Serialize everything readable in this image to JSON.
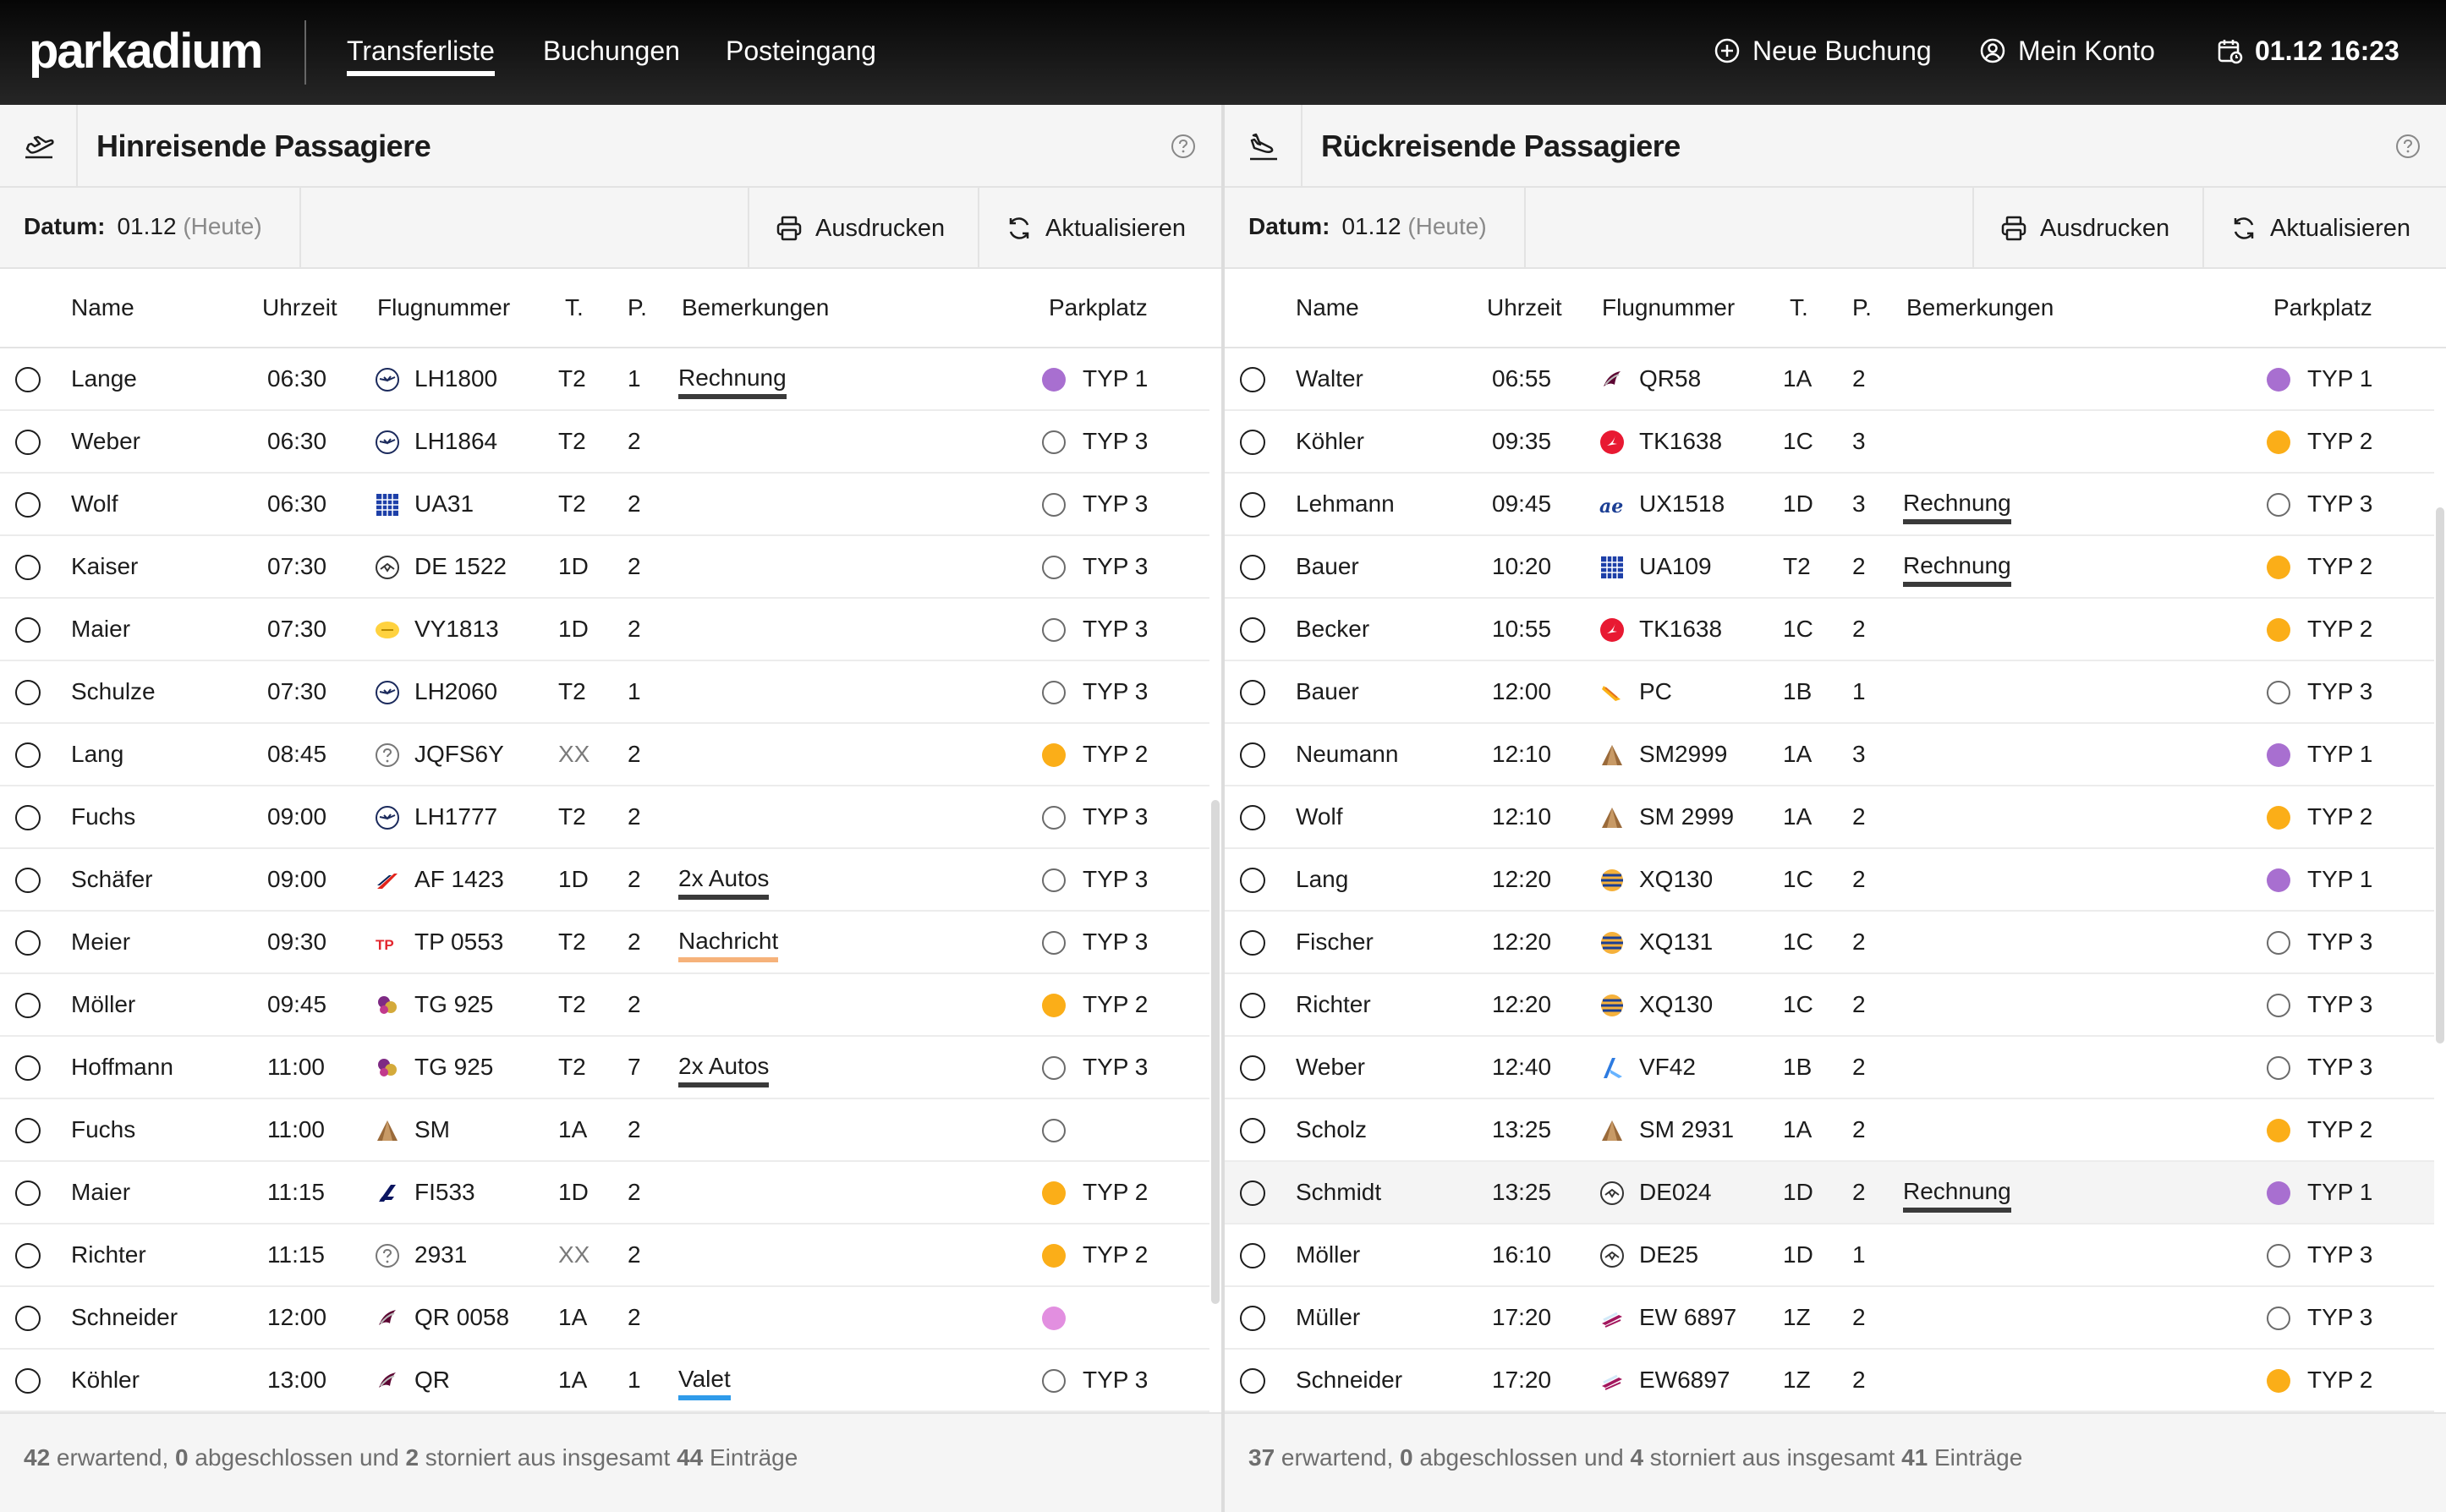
{
  "app": {
    "logo": "parkadium"
  },
  "nav": {
    "items": [
      "Transferliste",
      "Buchungen",
      "Posteingang"
    ],
    "active": "Transferliste"
  },
  "topbar": {
    "new_booking": "Neue Buchung",
    "account": "Mein Konto",
    "datetime": "01.12  16:23"
  },
  "colors": {
    "purple": "#a86fd0",
    "orange": "#fbae18",
    "pink": "#e28fe0",
    "note_default": "#3a3a3a",
    "note_orange": "#f6b27a",
    "note_blue": "#2f9bea"
  },
  "left": {
    "title": "Hinreisende Passagiere",
    "icon": "plane-departure-icon",
    "date_label": "Datum:",
    "date_value": "01.12",
    "date_hint": "(Heute)",
    "print_label": "Ausdrucken",
    "refresh_label": "Aktualisieren",
    "columns": [
      "Name",
      "Uhrzeit",
      "Flugnummer",
      "T.",
      "P.",
      "Bemerkungen",
      "Parkplatz"
    ],
    "rows": [
      {
        "name": "Lange",
        "time": "06:30",
        "airline": "lufthansa-icon",
        "flight": "LH1800",
        "t": "T2",
        "p": "1",
        "note": "Rechnung",
        "note_color": "#3a3a3a",
        "park": "TYP 1",
        "dot": "#a86fd0"
      },
      {
        "name": "Weber",
        "time": "06:30",
        "airline": "lufthansa-icon",
        "flight": "LH1864",
        "t": "T2",
        "p": "2",
        "note": "",
        "park": "TYP 3",
        "dot": "empty"
      },
      {
        "name": "Wolf",
        "time": "06:30",
        "airline": "united-icon",
        "flight": "UA31",
        "t": "T2",
        "p": "2",
        "note": "",
        "park": "TYP 3",
        "dot": "empty"
      },
      {
        "name": "Kaiser",
        "time": "07:30",
        "airline": "condor-icon",
        "flight": "DE 1522",
        "t": "1D",
        "p": "2",
        "note": "",
        "park": "TYP 3",
        "dot": "empty"
      },
      {
        "name": "Maier",
        "time": "07:30",
        "airline": "vueling-icon",
        "flight": "VY1813",
        "t": "1D",
        "p": "2",
        "note": "",
        "park": "TYP 3",
        "dot": "empty"
      },
      {
        "name": "Schulze",
        "time": "07:30",
        "airline": "lufthansa-icon",
        "flight": "LH2060",
        "t": "T2",
        "p": "1",
        "note": "",
        "park": "TYP 3",
        "dot": "empty"
      },
      {
        "name": "Lang",
        "time": "08:45",
        "airline": "unknown-airline-icon",
        "flight": "JQFS6Y",
        "t": "XX",
        "p": "2",
        "note": "",
        "park": "TYP 2",
        "dot": "#fbae18"
      },
      {
        "name": "Fuchs",
        "time": "09:00",
        "airline": "lufthansa-icon",
        "flight": "LH1777",
        "t": "T2",
        "p": "2",
        "note": "",
        "park": "TYP 3",
        "dot": "empty"
      },
      {
        "name": "Schäfer",
        "time": "09:00",
        "airline": "air-france-icon",
        "flight": "AF 1423",
        "t": "1D",
        "p": "2",
        "note": "2x Autos",
        "note_color": "#3a3a3a",
        "park": "TYP 3",
        "dot": "empty"
      },
      {
        "name": "Meier",
        "time": "09:30",
        "airline": "tap-icon",
        "flight": "TP 0553",
        "t": "T2",
        "p": "2",
        "note": "Nachricht",
        "note_color": "#f6b27a",
        "park": "TYP 3",
        "dot": "empty"
      },
      {
        "name": "Möller",
        "time": "09:45",
        "airline": "thai-icon",
        "flight": "TG 925",
        "t": "T2",
        "p": "2",
        "note": "",
        "park": "TYP 2",
        "dot": "#fbae18"
      },
      {
        "name": "Hoffmann",
        "time": "11:00",
        "airline": "thai-icon",
        "flight": "TG 925",
        "t": "T2",
        "p": "7",
        "note": "2x Autos",
        "note_color": "#3a3a3a",
        "park": "TYP 3",
        "dot": "empty"
      },
      {
        "name": "Fuchs",
        "time": "11:00",
        "airline": "sas-icon",
        "flight": "SM",
        "t": "1A",
        "p": "2",
        "note": "",
        "park": "",
        "dot": "empty"
      },
      {
        "name": "Maier",
        "time": "11:15",
        "airline": "finnair-icon",
        "flight": "FI533",
        "t": "1D",
        "p": "2",
        "note": "",
        "park": "TYP 2",
        "dot": "#fbae18"
      },
      {
        "name": "Richter",
        "time": "11:15",
        "airline": "unknown-airline-icon",
        "flight": "2931",
        "t": "XX",
        "p": "2",
        "note": "",
        "park": "TYP 2",
        "dot": "#fbae18"
      },
      {
        "name": "Schneider",
        "time": "12:00",
        "airline": "qatar-icon",
        "flight": "QR 0058",
        "t": "1A",
        "p": "2",
        "note": "",
        "park": "",
        "dot": "#e28fe0"
      },
      {
        "name": "Köhler",
        "time": "13:00",
        "airline": "qatar-icon",
        "flight": "QR",
        "t": "1A",
        "p": "1",
        "note": "Valet",
        "note_color": "#2f9bea",
        "park": "TYP 3",
        "dot": "empty"
      }
    ],
    "footer": {
      "waiting": "42",
      "waiting_label": " erwartend, ",
      "done": "0",
      "done_label": " abgeschlossen und ",
      "cancelled": "2",
      "cancelled_label": " storniert aus insgesamt ",
      "total": "44",
      "total_label": " Einträge"
    }
  },
  "right": {
    "title": "Rückreisende Passagiere",
    "icon": "plane-arrival-icon",
    "date_label": "Datum:",
    "date_value": "01.12",
    "date_hint": "(Heute)",
    "print_label": "Ausdrucken",
    "refresh_label": "Aktualisieren",
    "columns": [
      "Name",
      "Uhrzeit",
      "Flugnummer",
      "T.",
      "P.",
      "Bemerkungen",
      "Parkplatz"
    ],
    "rows": [
      {
        "name": "Walter",
        "time": "06:55",
        "airline": "qatar-icon",
        "flight": "QR58",
        "t": "1A",
        "p": "2",
        "note": "",
        "park": "TYP 1",
        "dot": "#a86fd0"
      },
      {
        "name": "Köhler",
        "time": "09:35",
        "airline": "turkish-icon",
        "flight": "TK1638",
        "t": "1C",
        "p": "3",
        "note": "",
        "park": "TYP 2",
        "dot": "#fbae18"
      },
      {
        "name": "Lehmann",
        "time": "09:45",
        "airline": "air-europa-icon",
        "flight": "UX1518",
        "t": "1D",
        "p": "3",
        "note": "Rechnung",
        "note_color": "#3a3a3a",
        "park": "TYP 3",
        "dot": "empty"
      },
      {
        "name": "Bauer",
        "time": "10:20",
        "airline": "united-icon",
        "flight": "UA109",
        "t": "T2",
        "p": "2",
        "note": "Rechnung",
        "note_color": "#3a3a3a",
        "park": "TYP 2",
        "dot": "#fbae18"
      },
      {
        "name": "Becker",
        "time": "10:55",
        "airline": "turkish-icon",
        "flight": "TK1638",
        "t": "1C",
        "p": "2",
        "note": "",
        "park": "TYP 2",
        "dot": "#fbae18"
      },
      {
        "name": "Bauer",
        "time": "12:00",
        "airline": "pegasus-icon",
        "flight": "PC",
        "t": "1B",
        "p": "1",
        "note": "",
        "park": "TYP 3",
        "dot": "empty"
      },
      {
        "name": "Neumann",
        "time": "12:10",
        "airline": "sas-icon",
        "flight": "SM2999",
        "t": "1A",
        "p": "3",
        "note": "",
        "park": "TYP 1",
        "dot": "#a86fd0"
      },
      {
        "name": "Wolf",
        "time": "12:10",
        "airline": "sas-icon",
        "flight": "SM 2999",
        "t": "1A",
        "p": "2",
        "note": "",
        "park": "TYP 2",
        "dot": "#fbae18"
      },
      {
        "name": "Lang",
        "time": "12:20",
        "airline": "sunexpress-icon",
        "flight": "XQ130",
        "t": "1C",
        "p": "2",
        "note": "",
        "park": "TYP 1",
        "dot": "#a86fd0"
      },
      {
        "name": "Fischer",
        "time": "12:20",
        "airline": "sunexpress-icon",
        "flight": "XQ131",
        "t": "1C",
        "p": "2",
        "note": "",
        "park": "TYP 3",
        "dot": "empty"
      },
      {
        "name": "Richter",
        "time": "12:20",
        "airline": "sunexpress-icon",
        "flight": "XQ130",
        "t": "1C",
        "p": "2",
        "note": "",
        "park": "TYP 3",
        "dot": "empty"
      },
      {
        "name": "Weber",
        "time": "12:40",
        "airline": "flyone-icon",
        "flight": "VF42",
        "t": "1B",
        "p": "2",
        "note": "",
        "park": "TYP 3",
        "dot": "empty"
      },
      {
        "name": "Scholz",
        "time": "13:25",
        "airline": "sas-icon",
        "flight": "SM 2931",
        "t": "1A",
        "p": "2",
        "note": "",
        "park": "TYP 2",
        "dot": "#fbae18"
      },
      {
        "name": "Schmidt",
        "time": "13:25",
        "airline": "condor-icon",
        "flight": "DE024",
        "t": "1D",
        "p": "2",
        "note": "Rechnung",
        "note_color": "#3a3a3a",
        "park": "TYP 1",
        "dot": "#a86fd0",
        "highlight": true
      },
      {
        "name": "Möller",
        "time": "16:10",
        "airline": "condor-icon",
        "flight": "DE25",
        "t": "1D",
        "p": "1",
        "note": "",
        "park": "TYP 3",
        "dot": "empty"
      },
      {
        "name": "Müller",
        "time": "17:20",
        "airline": "eurowings-icon",
        "flight": "EW 6897",
        "t": "1Z",
        "p": "2",
        "note": "",
        "park": "TYP 3",
        "dot": "empty"
      },
      {
        "name": "Schneider",
        "time": "17:20",
        "airline": "eurowings-icon",
        "flight": "EW6897",
        "t": "1Z",
        "p": "2",
        "note": "",
        "park": "TYP 2",
        "dot": "#fbae18"
      }
    ],
    "footer": {
      "waiting": "37",
      "waiting_label": " erwartend, ",
      "done": "0",
      "done_label": " abgeschlossen und ",
      "cancelled": "4",
      "cancelled_label": " storniert aus insgesamt ",
      "total": "41",
      "total_label": " Einträge"
    }
  }
}
